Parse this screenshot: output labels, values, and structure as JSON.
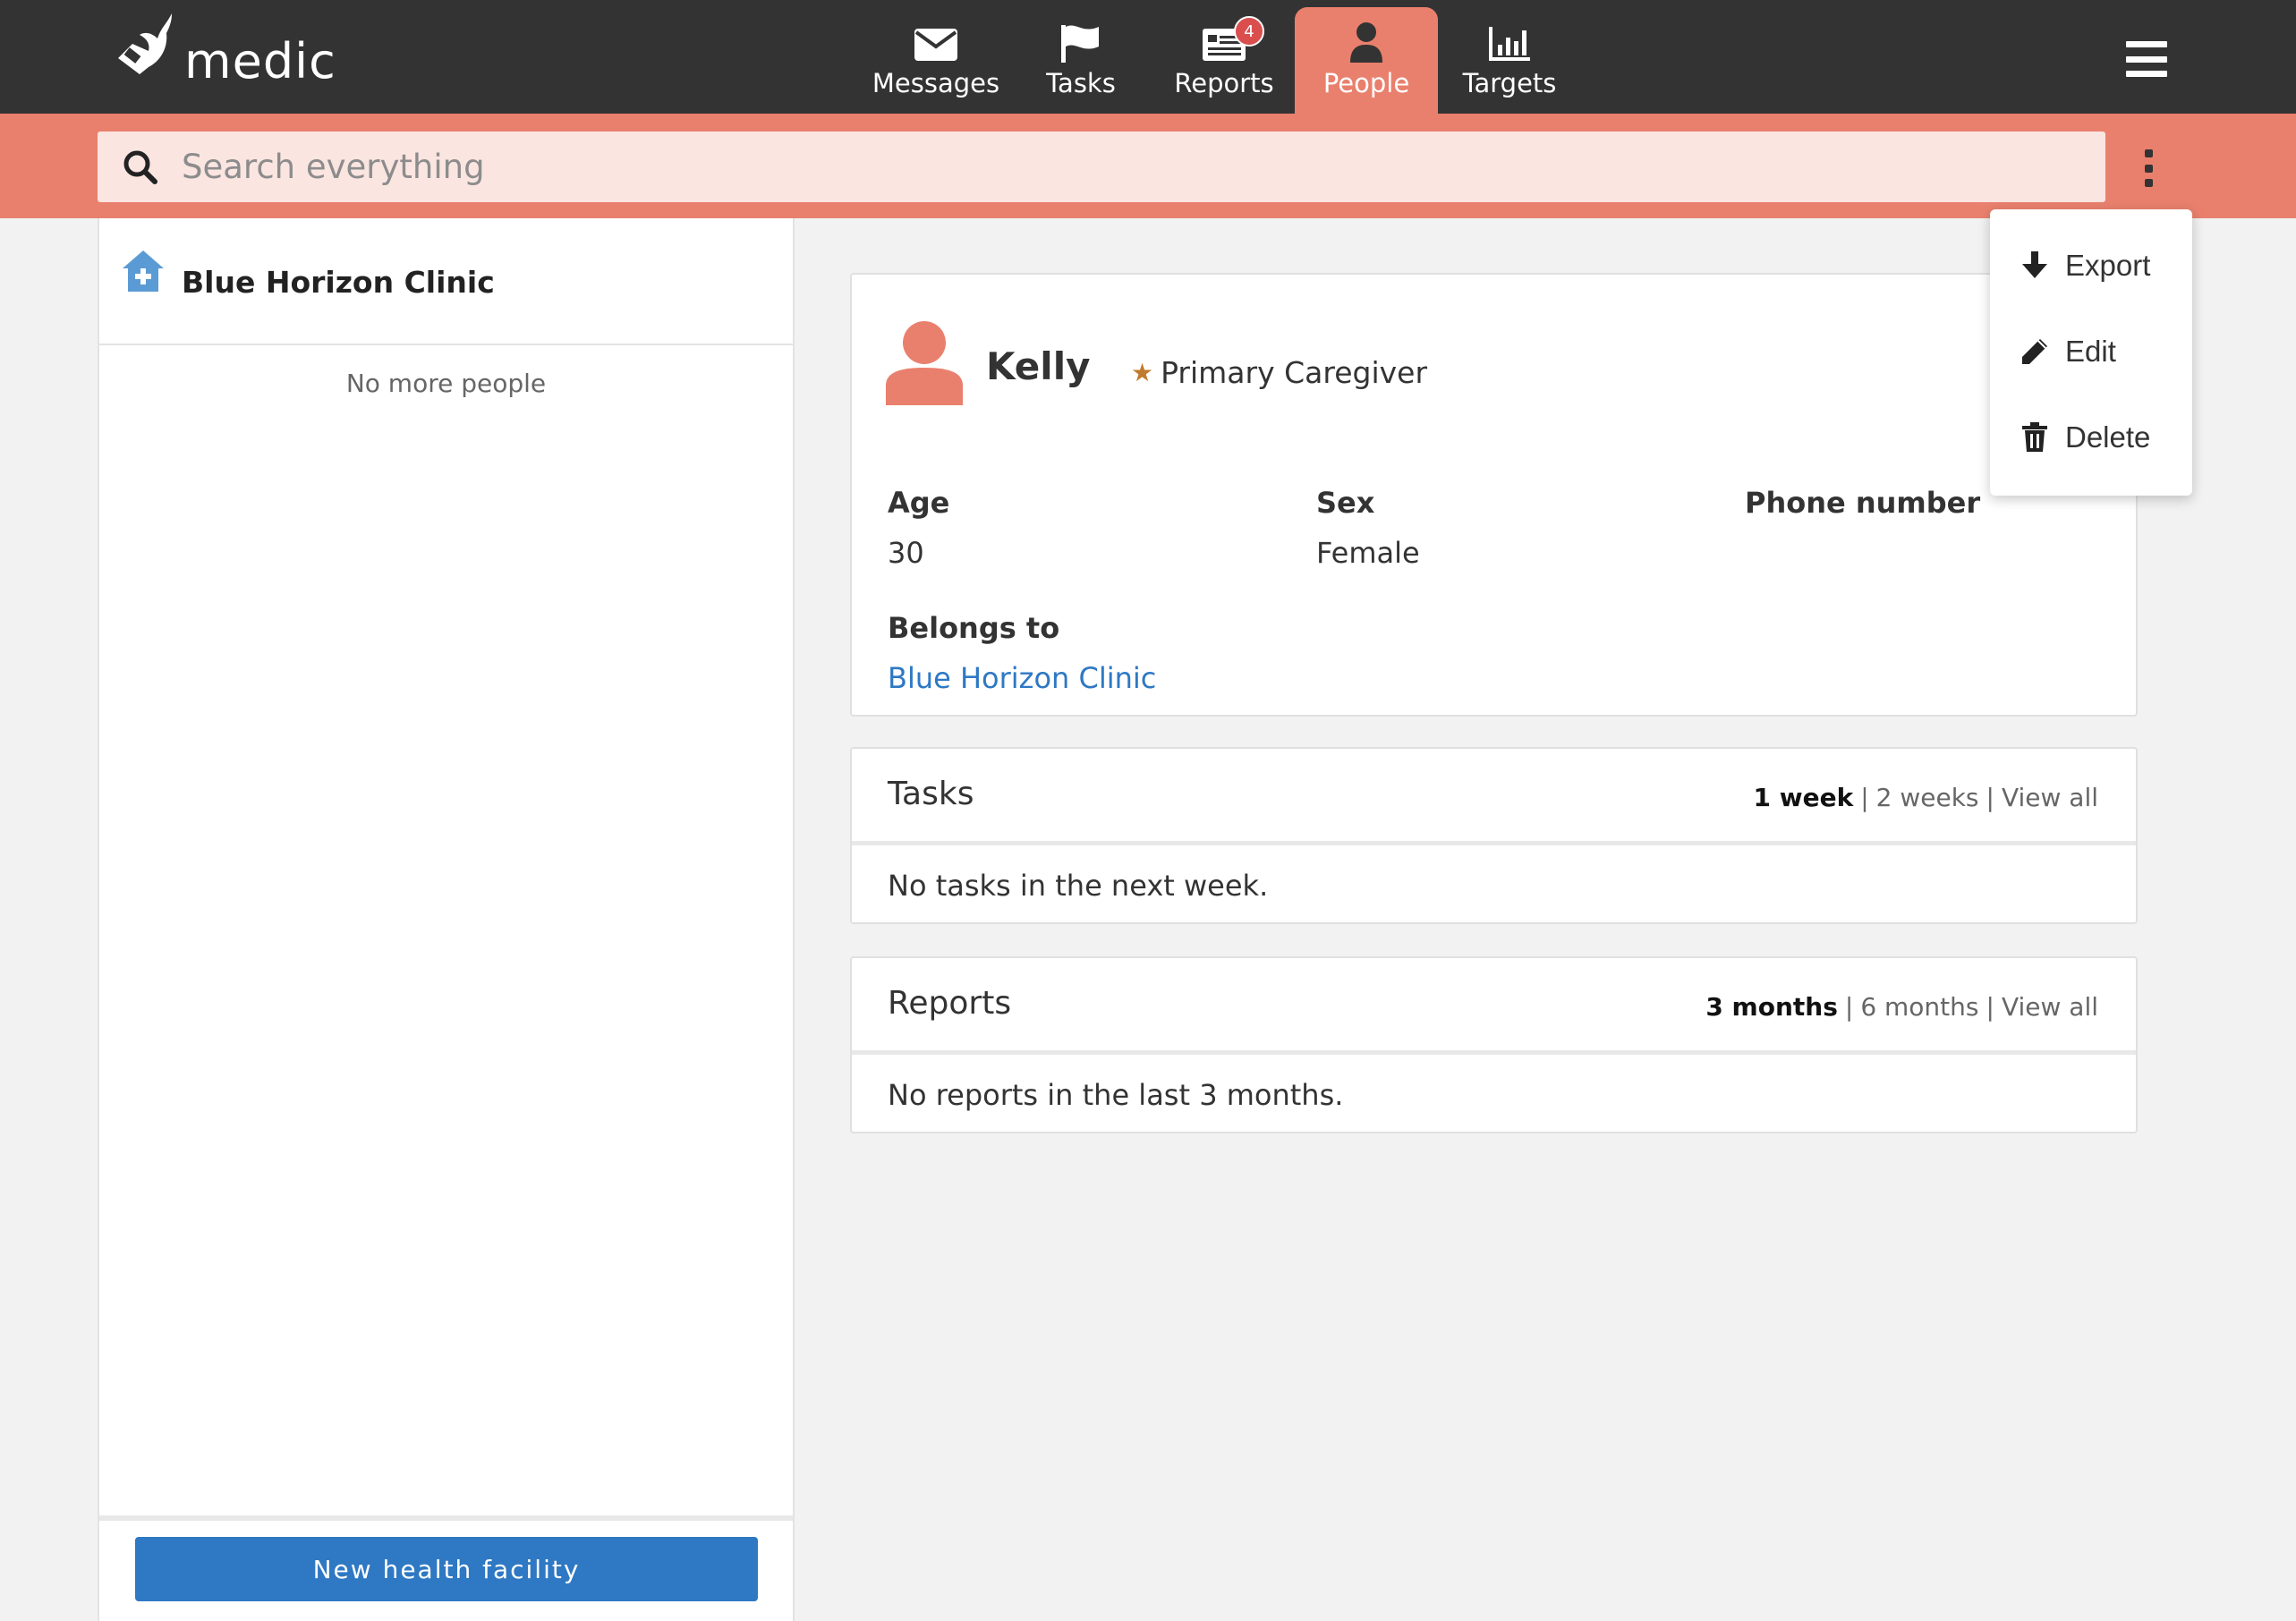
{
  "app": {
    "logo_text": "medic"
  },
  "nav": {
    "tabs": [
      {
        "label": "Messages",
        "icon": "envelope-icon"
      },
      {
        "label": "Tasks",
        "icon": "flag-icon"
      },
      {
        "label": "Reports",
        "icon": "reports-icon",
        "badge": "4"
      },
      {
        "label": "People",
        "icon": "person-icon",
        "active": true
      },
      {
        "label": "Targets",
        "icon": "bar-chart-icon"
      }
    ],
    "active_color": "#e9806d",
    "bar_color": "#333333"
  },
  "search": {
    "placeholder": "Search everything"
  },
  "left_panel": {
    "facility_name": "Blue Horizon Clinic",
    "empty_text": "No more people",
    "new_button": "New health facility"
  },
  "person": {
    "name": "Kelly",
    "role": "Primary Caregiver",
    "fields": {
      "age_label": "Age",
      "age_value": "30",
      "sex_label": "Sex",
      "sex_value": "Female",
      "phone_label": "Phone number",
      "belongs_label": "Belongs to",
      "belongs_value": "Blue Horizon Clinic"
    }
  },
  "tasks_section": {
    "title": "Tasks",
    "filters": [
      "1 week",
      "2 weeks",
      "View all"
    ],
    "empty": "No tasks in the next week."
  },
  "reports_section": {
    "title": "Reports",
    "filters": [
      "3 months",
      "6 months",
      "View all"
    ],
    "empty": "No reports in the last 3 months."
  },
  "menu": {
    "items": [
      {
        "label": "Export",
        "icon": "download-icon"
      },
      {
        "label": "Edit",
        "icon": "pencil-icon"
      },
      {
        "label": "Delete",
        "icon": "trash-icon"
      }
    ]
  }
}
